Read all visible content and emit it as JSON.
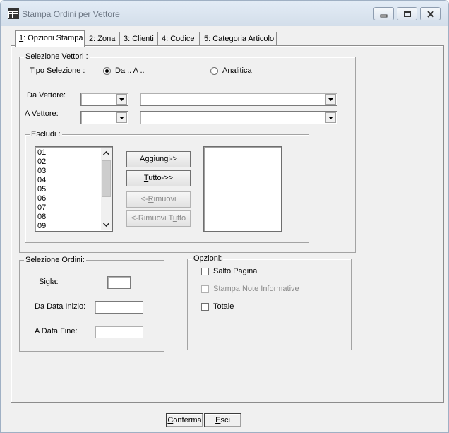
{
  "window": {
    "title": "Stampa  Ordini per Vettore",
    "minimize_icon": "minimize-icon",
    "maximize_icon": "maximize-icon",
    "close_icon": "close-icon"
  },
  "tabs": [
    {
      "key": "1",
      "label": ": Opzioni Stampa",
      "active": true
    },
    {
      "key": "2",
      "label": ": Zona"
    },
    {
      "key": "3",
      "label": ": Clienti"
    },
    {
      "key": "4",
      "label": ": Codice"
    },
    {
      "key": "5",
      "label": ": Categoria Articolo"
    }
  ],
  "selezione_vettori": {
    "title": "Selezione Vettori :",
    "tipo_label": "Tipo Selezione :",
    "option_range": "Da .. A ..",
    "option_analitica": "Analitica",
    "selected": "Da .. A ..",
    "da_vettore_label": "Da Vettore:",
    "a_vettore_label": "A Vettore:",
    "da_vettore_code": "",
    "da_vettore_desc": "",
    "a_vettore_code": "",
    "a_vettore_desc": ""
  },
  "escludi": {
    "title": "Escludi :",
    "available": [
      "01",
      "02",
      "03",
      "04",
      "05",
      "06",
      "07",
      "08",
      "09"
    ],
    "excluded": [],
    "aggiungi": "Aggiungi->",
    "tutto_ul": "T",
    "tutto_rest": "utto->>",
    "rimuovi_pre": "<-",
    "rimuovi_ul": "R",
    "rimuovi_rest": "imuovi",
    "rimuovi_tutto_pre": "<-Rimuovi T",
    "rimuovi_tutto_ul": "u",
    "rimuovi_tutto_rest": "tto"
  },
  "selezione_ordini": {
    "title": "Selezione Ordini:",
    "sigla_label": "Sigla:",
    "sigla_value": "",
    "da_data_label": "Da Data Inizio:",
    "da_data_value": "",
    "a_data_label": "A Data Fine:",
    "a_data_value": ""
  },
  "opzioni": {
    "title": "Opzioni:",
    "salto_pagina": "Salto Pagina",
    "salto_pagina_checked": false,
    "stampa_note": "Stampa Note Informative",
    "stampa_note_checked": false,
    "totale": "Totale",
    "totale_checked": false
  },
  "footer": {
    "conferma_ul": "C",
    "conferma_rest": "onferma",
    "esci_ul": "E",
    "esci_rest": "sci"
  }
}
